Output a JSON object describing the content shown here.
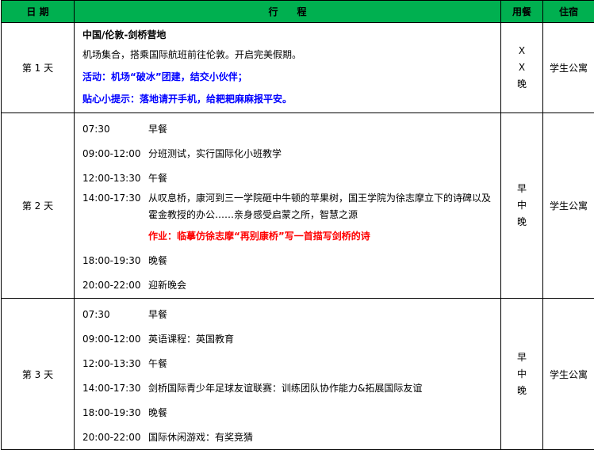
{
  "header": {
    "date": "日 期",
    "itinerary": "行　　程",
    "meals": "用餐",
    "lodging": "住宿"
  },
  "days": [
    {
      "label": "第 1 天",
      "meals": [
        "X",
        "X",
        "晚"
      ],
      "lodging": "学生公寓",
      "title": "中国/伦敦-剑桥营地",
      "text": "机场集合，搭乘国际航班前往伦敦。开启完美假期。",
      "activity": "活动：机场“破冰”团建，结交小伙伴；",
      "tip": "贴心小提示：落地请开手机，给耙耙麻麻报平安。"
    },
    {
      "label": "第 2 天",
      "meals": [
        "早",
        "中",
        "晚"
      ],
      "lodging": "学生公寓",
      "items": [
        {
          "time": "07:30",
          "desc": "早餐"
        },
        {
          "time": "09:00-12:00",
          "desc": "分班测试，实行国际化小班教学"
        },
        {
          "time": "12:00-13:30",
          "desc": "午餐"
        },
        {
          "time": "14:00-17:30",
          "desc": "从叹息桥，康河到三一学院砸中牛顿的苹果树，国王学院为徐志摩立下的诗碑以及霍金教授的办公……亲身感受启蒙之所，智慧之源"
        },
        {
          "time": "18:00-19:30",
          "desc": "晚餐"
        },
        {
          "time": "20:00-22:00",
          "desc": "迎新晚会"
        }
      ],
      "homework": "作业：临摹仿徐志摩“再别康桥”写一首描写剑桥的诗"
    },
    {
      "label": "第 3 天",
      "meals": [
        "早",
        "中",
        "晚"
      ],
      "lodging": "学生公寓",
      "items": [
        {
          "time": "07:30",
          "desc": "早餐"
        },
        {
          "time": "09:00-12:00",
          "desc": "英语课程：英国教育"
        },
        {
          "time": "12:00-13:30",
          "desc": "午餐"
        },
        {
          "time": "14:00-17:30",
          "desc": "剑桥国际青少年足球友谊联赛：训练团队协作能力&拓展国际友谊"
        },
        {
          "time": "18:00-19:30",
          "desc": "晚餐"
        },
        {
          "time": "20:00-22:00",
          "desc": "国际休闲游戏：有奖竞猜"
        }
      ]
    }
  ]
}
